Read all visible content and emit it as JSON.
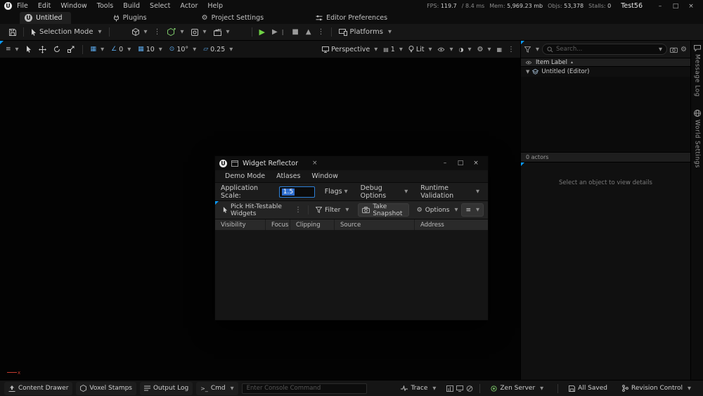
{
  "colors": {
    "accent_blue": "#0b9bfa",
    "play_green": "#6fd245",
    "selection_blue": "#2f6fd0",
    "axis_red": "#c23b2e"
  },
  "menubar": {
    "items": [
      "File",
      "Edit",
      "Window",
      "Tools",
      "Build",
      "Select",
      "Actor",
      "Help"
    ],
    "stats": {
      "fps_label": "FPS:",
      "fps_value": "119.7",
      "ms_value": "/ 8.4 ms",
      "mem_label": "Mem:",
      "mem_value": "5,969.23 mb",
      "objs_label": "Objs:",
      "objs_value": "53,378",
      "stalls_label": "Stalls:",
      "stalls_value": "0"
    },
    "project_title": "Test56",
    "window_controls": {
      "minimize": "–",
      "maximize": "□",
      "close": "×"
    }
  },
  "tabbar": {
    "active_tab": "Untitled",
    "plugins": "Plugins",
    "project_settings": "Project Settings",
    "editor_preferences": "Editor Preferences"
  },
  "toolbar": {
    "selection_mode": "Selection Mode",
    "platforms": "Platforms"
  },
  "viewport": {
    "snap_angle": "0",
    "snap_grid": "10",
    "snap_rotate": "10°",
    "snap_scale": "0.25",
    "perspective": "Perspective",
    "screen_pct": "1",
    "view_mode": "Lit",
    "axis_label": "x"
  },
  "outliner": {
    "search_placeholder": "Search...",
    "column_header": "Item Label",
    "sort_arrow": "▴",
    "rows": [
      {
        "label": "Untitled (Editor)"
      }
    ],
    "footer": "0 actors"
  },
  "details": {
    "empty_hint": "Select an object to view details"
  },
  "side_tabs": [
    {
      "label": "Message Log"
    },
    {
      "label": "World Settings"
    }
  ],
  "reflector": {
    "title": "Widget Reflector",
    "menu": [
      "Demo Mode",
      "Atlases",
      "Window"
    ],
    "app_scale_label": "Application Scale:",
    "app_scale_value": "1.5",
    "flags_label": "Flags",
    "debug_options_label": "Debug Options",
    "runtime_validation_label": "Runtime Validation",
    "pick_button": "Pick Hit-Testable Widgets",
    "filter_label": "Filter",
    "snapshot_button": "Take Snapshot",
    "options_label": "Options",
    "columns": [
      "Visibility",
      "Focus",
      "Clipping",
      "Source",
      "Address"
    ],
    "tab_close": "×",
    "window_controls": {
      "minimize": "–",
      "maximize": "□",
      "close": "×"
    }
  },
  "statusbar": {
    "content_drawer": "Content Drawer",
    "voxel_stamps": "Voxel Stamps",
    "output_log": "Output Log",
    "cmd": "Cmd",
    "console_placeholder": "Enter Console Command",
    "trace": "Trace",
    "zen_server": "Zen Server",
    "all_saved": "All Saved",
    "revision_control": "Revision Control"
  }
}
